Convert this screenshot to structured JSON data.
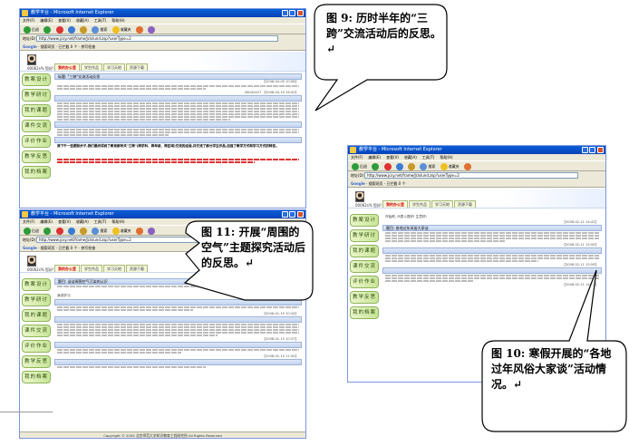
{
  "browser": {
    "title": "教学平台 - Microsoft Internet Explorer",
    "menu": [
      "文件(F)",
      "编辑(E)",
      "查看(V)",
      "收藏(A)",
      "工具(T)",
      "帮助(H)"
    ],
    "toolbar": [
      "后退",
      "搜索",
      "收藏夹"
    ],
    "address_label": "地址(D)",
    "address": "http://www.jcsy.net/frame/Jclslund.zsp?userType=2",
    "address_go": "转到",
    "google_label": "Google",
    "google_items": [
      "搜索网页",
      "已拦截 0 个",
      "拼写检查",
      "选项"
    ]
  },
  "portal": {
    "user": "00062s%  您好!",
    "tabs": [
      "我的办公室",
      "学生作品",
      "学习天地",
      "资源下载"
    ],
    "sidebar": [
      "教案设计",
      "教学研讨",
      "我的课题",
      "课件交流",
      "评价作业",
      "教学反思",
      "我的档案"
    ],
    "footer": "Copyright © 2005 北京师范大学知识教育工程研究所  All Rights Reserved"
  },
  "win9": {
    "thread_title": "标题: \"三跨\"交流活动反思",
    "thread_reply": "我要回复",
    "author_post": "【2008-04-09 10:06】",
    "text_red": "我下午一些跟踪步子,我们最终得到了教育部有关\"三跨\"(跨学科、跨年级、跨区域)交流的经验,并交流了部分学生作品,加强了教学方式和学习方式的转变。",
    "meta2": "08042427 【2008-04-10 16:42】"
  },
  "win11": {
    "thread_title": "题目: 谈谈周围空气污染的认识",
    "reply_label": "我说学习:",
    "meta1": "【2008-01-15 10:36】",
    "meta2": "【2008-01-15 10:34】",
    "meta3": "【2008-01-15 10:37】",
    "meta4": "【2008-01-15 11:00】"
  },
  "win10": {
    "greeting": "开始吧, 代表人提好! 生意好!",
    "thread_title": "题目: 各地过年风俗大家谈",
    "meta1": "【2008-02-11 14:42】",
    "meta2": "【2008-02-11 15:50】",
    "meta3": "【2008-02-11 15:59】",
    "meta4": "【2008-02-11 14:09】"
  },
  "callouts": {
    "fig9": "图 9: 历时半年的“三跨”交流活动后的反思。↵",
    "fig11": "图 11: 开展“周围的空气”主题探究活动后的反思。↵",
    "fig10": "图 10: 寒假开展的“各地过年风俗大家谈”活动情况。↵"
  }
}
